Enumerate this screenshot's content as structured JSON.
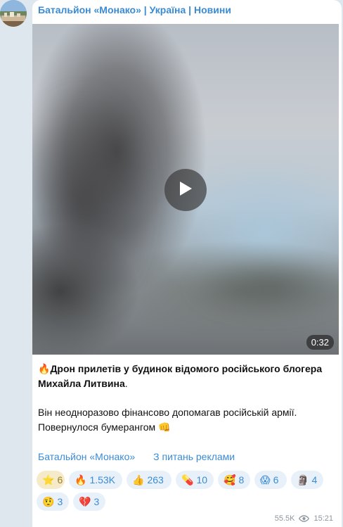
{
  "channel": {
    "name": "Батальйон «Монако» | Україна | Новини"
  },
  "video": {
    "duration": "0:32"
  },
  "post": {
    "headline_emoji": "🔥",
    "headline": "Дрон прилетів у будинок відомого російського блогера Михайла Литвина",
    "headline_end": ".",
    "body_line1": "Він неодноразово фінансово допомагав російській армії.",
    "body_line2": "Повернулося бумерангом",
    "body_emoji": "👊"
  },
  "links": {
    "channel": "Батальйон «Монако»",
    "ads": "З питань реклами"
  },
  "reactions": [
    {
      "emoji": "⭐",
      "count": "6",
      "chosen": true
    },
    {
      "emoji": "🔥",
      "count": "1.53K"
    },
    {
      "emoji": "👍",
      "count": "263"
    },
    {
      "emoji": "💊",
      "count": "10"
    },
    {
      "emoji": "🥰",
      "count": "8"
    },
    {
      "emoji": "😱",
      "count": "6"
    },
    {
      "emoji": "🗿",
      "count": "4"
    },
    {
      "emoji": "🤨",
      "count": "3"
    },
    {
      "emoji": "💔",
      "count": "3"
    }
  ],
  "meta": {
    "views": "55.5K",
    "time": "15:21"
  },
  "icons": {
    "play": "play-icon",
    "views": "eye-icon"
  },
  "colors": {
    "link": "#3a8bd4",
    "reaction_bg": "#e8f1fa",
    "reaction_chosen_bg": "#f6ebc8"
  }
}
